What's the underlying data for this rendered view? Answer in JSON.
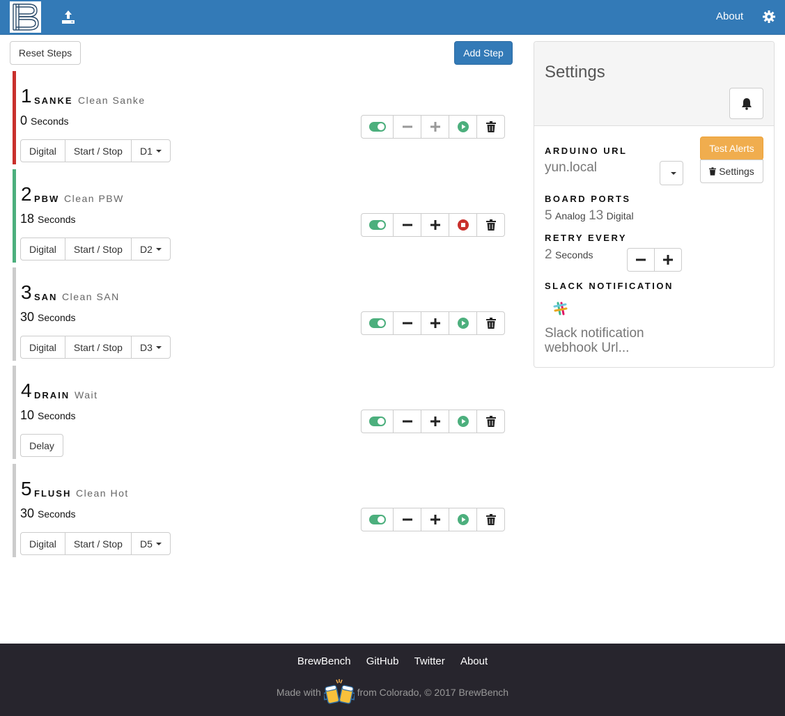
{
  "navbar": {
    "about_label": "About"
  },
  "toolbar": {
    "reset_label": "Reset Steps",
    "add_label": "Add Step"
  },
  "colors": {
    "primary": "#337ab7",
    "active_red": "#c9302c",
    "active_green": "#4caf7d",
    "inactive_gray": "#cccccc",
    "warning": "#f0ad4e"
  },
  "steps": [
    {
      "num": "1",
      "name": "SANKE",
      "desc": "Clean Sanke",
      "duration": "0",
      "unit": "Seconds",
      "type": "Digital",
      "action": "Start / Stop",
      "pin": "D1",
      "state": "play"
    },
    {
      "num": "2",
      "name": "PBW",
      "desc": "Clean PBW",
      "duration": "18",
      "unit": "Seconds",
      "type": "Digital",
      "action": "Start / Stop",
      "pin": "D2",
      "state": "stop"
    },
    {
      "num": "3",
      "name": "SAN",
      "desc": "Clean SAN",
      "duration": "30",
      "unit": "Seconds",
      "type": "Digital",
      "action": "Start / Stop",
      "pin": "D3",
      "state": "play"
    },
    {
      "num": "4",
      "name": "DRAIN",
      "desc": "Wait",
      "duration": "10",
      "unit": "Seconds",
      "type": "Delay",
      "state": "play"
    },
    {
      "num": "5",
      "name": "FLUSH",
      "desc": "Clean Hot",
      "duration": "30",
      "unit": "Seconds",
      "type": "Digital",
      "action": "Start / Stop",
      "pin": "D5",
      "state": "play"
    }
  ],
  "settings": {
    "title": "Settings",
    "test_alerts_label": "Test Alerts",
    "settings_button_label": "Settings",
    "arduino_url_label": "ARDUINO URL",
    "arduino_url_value": "yun.local",
    "board_ports_label": "BOARD PORTS",
    "analog_count": "5",
    "analog_label": "Analog",
    "digital_count": "13",
    "digital_label": "Digital",
    "retry_label": "RETRY EVERY",
    "retry_value": "2",
    "retry_unit": "Seconds",
    "slack_label": "SLACK NOTIFICATION",
    "slack_placeholder": "Slack notification webhook Url..."
  },
  "footer": {
    "links": [
      "BrewBench",
      "GitHub",
      "Twitter",
      "About"
    ],
    "made_with": "Made with",
    "from_text": "from Colorado, © 2017 BrewBench"
  }
}
